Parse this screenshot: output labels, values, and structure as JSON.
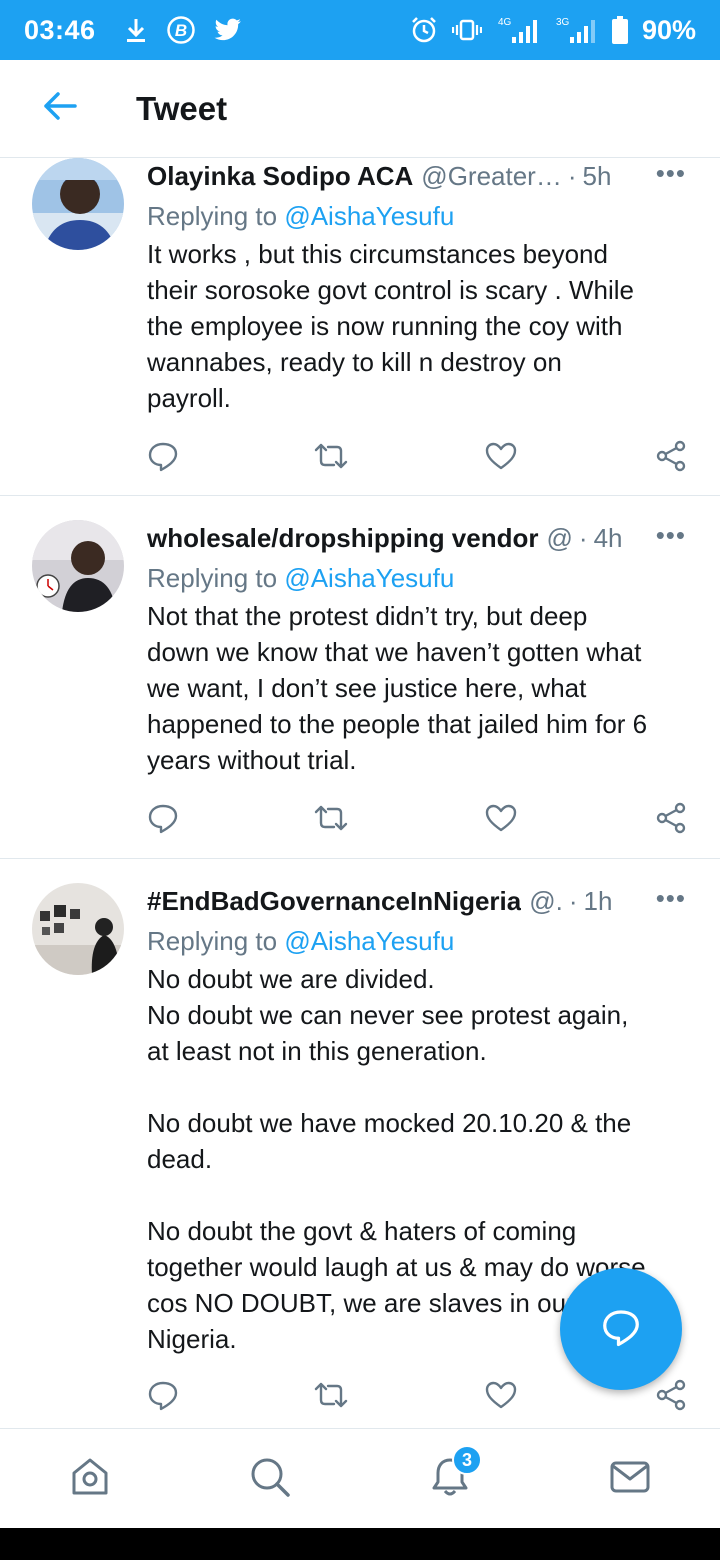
{
  "status_bar": {
    "time": "03:46",
    "net_4g": "4G",
    "net_3g": "3G",
    "battery": "90%"
  },
  "header": {
    "title": "Tweet"
  },
  "colors": {
    "accent": "#1da1f2",
    "secondary_text": "#657786",
    "primary_text": "#14171a",
    "divider": "#e1e8ed"
  },
  "tweets": [
    {
      "name": "Olayinka Sodipo ACA",
      "handle": "@Greater…",
      "time": "5h",
      "replying_prefix": "Replying to ",
      "replying_to": "@AishaYesufu",
      "text": "It works , but this circumstances beyond\ntheir sorosoke govt control is scary .  While\nthe employee is now running the coy with\nwannabes,  ready to kill n destroy on\npayroll."
    },
    {
      "name": "wholesale/dropshipping vendor",
      "handle": "@",
      "time": "4h",
      "replying_prefix": "Replying to ",
      "replying_to": "@AishaYesufu",
      "text": "Not that the protest didn’t try, but deep\ndown we know that we haven’t gotten what\nwe want, I don’t see justice here, what\nhappened to the people that jailed him for 6\nyears without trial."
    },
    {
      "name": "#EndBadGovernanceInNigeria",
      "handle": "@.",
      "time": "1h",
      "replying_prefix": "Replying to ",
      "replying_to": "@AishaYesufu",
      "text": "No doubt we are divided.\nNo doubt we can never see protest again,\nat least not in this generation.\n\nNo doubt we have mocked 20.10.20 & the\ndead.\n\nNo doubt the govt & haters of coming\ntogether would laugh at us & may do worse\ncos NO DOUBT, we are slaves in our own\nNigeria."
    }
  ],
  "bottom_nav": {
    "notifications_badge": "3"
  },
  "icons": [
    "back-arrow-icon",
    "reply-icon",
    "retweet-icon",
    "like-icon",
    "share-icon",
    "more-icon",
    "compose-icon",
    "home-icon",
    "search-icon",
    "bell-icon",
    "mail-icon"
  ]
}
